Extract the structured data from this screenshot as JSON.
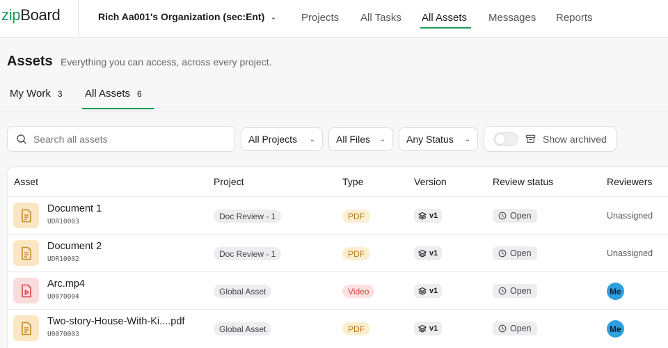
{
  "app": {
    "logo_prefix": "zip",
    "logo_suffix": "Board"
  },
  "header": {
    "organization": "Rich Aa001's Organization (sec:Ent)",
    "nav": [
      {
        "label": "Projects"
      },
      {
        "label": "All Tasks"
      },
      {
        "label": "All Assets"
      },
      {
        "label": "Messages"
      },
      {
        "label": "Reports"
      }
    ],
    "active_nav": "All Assets"
  },
  "page": {
    "title": "Assets",
    "subtitle": "Everything you can access, across every project."
  },
  "tabs": [
    {
      "label": "My Work",
      "count": "3"
    },
    {
      "label": "All Assets",
      "count": "6"
    }
  ],
  "active_tab": "All Assets",
  "filters": {
    "search_placeholder": "Search all assets",
    "projects": "All Projects",
    "files": "All Files",
    "status": "Any Status",
    "archived_label": "Show archived",
    "archived_on": false
  },
  "table": {
    "columns": [
      "Asset",
      "Project",
      "Type",
      "Version",
      "Review status",
      "Reviewers"
    ],
    "rows": [
      {
        "name": "Document 1",
        "id": "UDR10003",
        "project": "Doc Review - 1",
        "type": "PDF",
        "version": "v1",
        "status": "Open",
        "reviewer": "Unassigned",
        "icon": "document-icon"
      },
      {
        "name": "Document 2",
        "id": "UDR10002",
        "project": "Doc Review - 1",
        "type": "PDF",
        "version": "v1",
        "status": "Open",
        "reviewer": "Unassigned",
        "icon": "document-icon"
      },
      {
        "name": "Arc.mp4",
        "id": "U0070004",
        "project": "Global Asset",
        "type": "Video",
        "version": "v1",
        "status": "Open",
        "reviewer": "Me",
        "icon": "video-file-icon"
      },
      {
        "name": "Two-story-House-With-Ki....pdf",
        "id": "U0070003",
        "project": "Global Asset",
        "type": "PDF",
        "version": "v1",
        "status": "Open",
        "reviewer": "Me",
        "icon": "document-icon"
      }
    ]
  },
  "colors": {
    "accent": "#1a9b55",
    "pdf_bg": "#fcefcf",
    "pdf_text": "#b7791f",
    "video_bg": "#fde1e1",
    "video_text": "#d33b3b",
    "avatar": "#2ea0dd"
  }
}
